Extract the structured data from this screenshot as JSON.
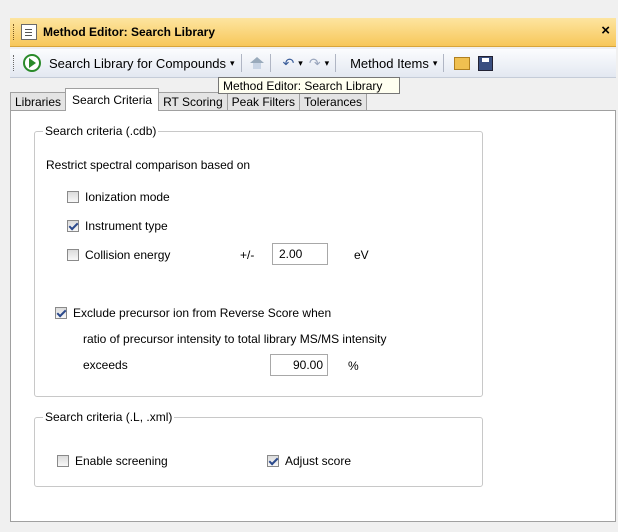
{
  "window": {
    "title": "Method Editor: Search Library",
    "close_glyph": "×"
  },
  "toolbar": {
    "run_label": "Search Library for Compounds",
    "method_items_label": "Method Items",
    "dropdown_glyph": "▾"
  },
  "tooltip": "Method Editor: Search Library",
  "tabs": [
    "Libraries",
    "Search Criteria",
    "RT Scoring",
    "Peak Filters",
    "Tolerances"
  ],
  "active_tab": "Search Criteria",
  "cdb": {
    "legend": "Search criteria (.cdb)",
    "restrict_label": "Restrict spectral comparison based on",
    "ionization_mode": {
      "label": "Ionization mode",
      "checked": false
    },
    "instrument_type": {
      "label": "Instrument type",
      "checked": true
    },
    "collision_energy": {
      "label": "Collision energy",
      "checked": false,
      "plusminus": "+/-",
      "value": "2.00",
      "unit": "eV"
    },
    "exclude_precursor": {
      "label_line1": "Exclude precursor ion from Reverse Score when",
      "label_line2": "ratio of precursor intensity to total library MS/MS intensity",
      "label_line3": "exceeds",
      "checked": true,
      "value": "90.00",
      "unit": "%"
    }
  },
  "lxml": {
    "legend": "Search criteria (.L, .xml)",
    "enable_screening": {
      "label": "Enable screening",
      "checked": false
    },
    "adjust_score": {
      "label": "Adjust score",
      "checked": true
    }
  },
  "icons": {
    "play": "play-icon",
    "home": "home-icon",
    "undo": "undo-icon",
    "redo": "redo-icon",
    "open": "open-folder-icon",
    "save": "save-icon"
  }
}
